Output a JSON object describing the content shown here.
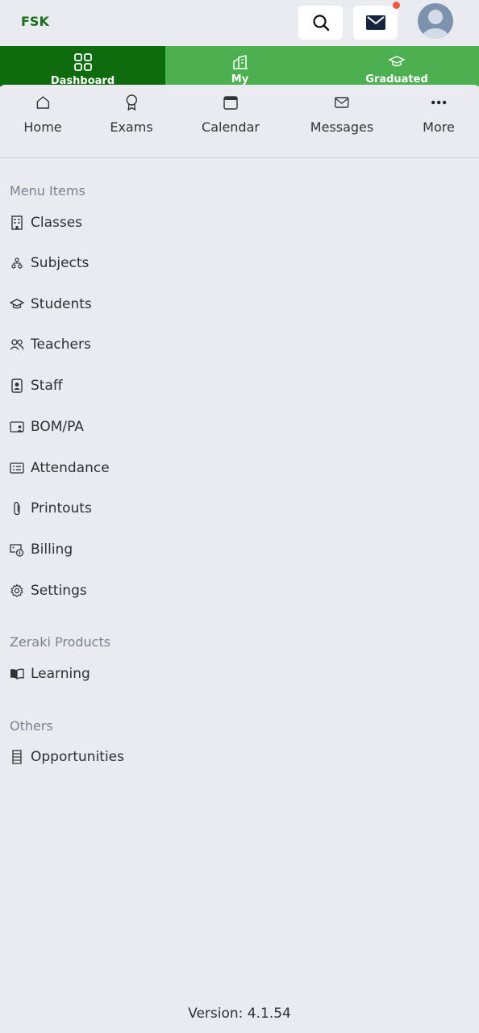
{
  "header": {
    "brand": "FSK",
    "icons": {
      "search": "search-icon",
      "mail": "mail-icon",
      "avatar": "user-avatar"
    },
    "colors": {
      "brand": "#1b6e1b",
      "notification": "#f0573f"
    }
  },
  "tabs": [
    {
      "label": "Dashboard",
      "icon": "grid-icon",
      "active": true
    },
    {
      "label": "My",
      "icon": "building-icon",
      "active": false
    },
    {
      "label": "Graduated",
      "icon": "graduation-cap-icon",
      "active": false
    }
  ],
  "tab_colors": {
    "active": "#0e6b0e",
    "inactive": "#4caf50"
  },
  "shortcuts": [
    {
      "label": "Home",
      "icon": "home-icon"
    },
    {
      "label": "Exams",
      "icon": "award-icon"
    },
    {
      "label": "Calendar",
      "icon": "calendar-icon"
    },
    {
      "label": "Messages",
      "icon": "envelope-icon"
    },
    {
      "label": "More",
      "icon": "more-icon"
    }
  ],
  "sections": {
    "menu": {
      "title": "Menu Items",
      "items": [
        {
          "label": "Classes",
          "icon": "building-icon"
        },
        {
          "label": "Subjects",
          "icon": "hierarchy-icon"
        },
        {
          "label": "Students",
          "icon": "graduation-cap-icon"
        },
        {
          "label": "Teachers",
          "icon": "people-icon"
        },
        {
          "label": "Staff",
          "icon": "id-badge-icon"
        },
        {
          "label": "BOM/PA",
          "icon": "person-screen-icon"
        },
        {
          "label": "Attendance",
          "icon": "checklist-icon"
        },
        {
          "label": "Printouts",
          "icon": "paperclip-icon"
        },
        {
          "label": "Billing",
          "icon": "billing-icon"
        },
        {
          "label": "Settings",
          "icon": "gear-icon"
        }
      ]
    },
    "products": {
      "title": "Zeraki Products",
      "items": [
        {
          "label": "Learning",
          "icon": "book-icon"
        }
      ]
    },
    "others": {
      "title": "Others",
      "items": [
        {
          "label": "Opportunities",
          "icon": "list-icon"
        }
      ]
    }
  },
  "footer": {
    "version": "Version: 4.1.54"
  }
}
